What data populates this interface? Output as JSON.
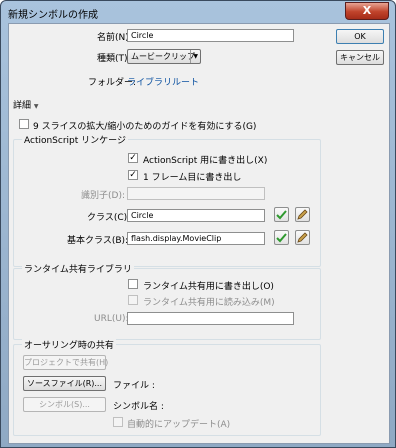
{
  "window": {
    "title": "新規シンボルの作成",
    "close": "X"
  },
  "form": {
    "name_label": "名前(N):",
    "name_value": "Circle",
    "type_label": "種類(T):",
    "type_value": "ムービークリップ",
    "folder_label": "フォルダー:",
    "folder_value": "ライブラリルート"
  },
  "buttons": {
    "ok": "OK",
    "cancel": "キャンセル"
  },
  "advanced": {
    "toggle": "詳細",
    "slice9": "9 スライスの拡大/縮小のためのガイドを有効にする(G)"
  },
  "actionscript": {
    "title": "ActionScript リンケージ",
    "export_as": "ActionScript 用に書き出し(X)",
    "export_frame1": "1 フレーム目に書き出し",
    "identifier_label": "識別子(D):",
    "class_label": "クラス(C):",
    "class_value": "Circle",
    "base_class_label": "基本クラス(B):",
    "base_class_value": "flash.display.MovieClip"
  },
  "runtime": {
    "title": "ランタイム共有ライブラリ",
    "export_sharing": "ランタイム共有用に書き出し(O)",
    "import_sharing": "ランタイム共有用に読み込み(M)",
    "url_label": "URL(U):"
  },
  "authoring": {
    "title": "オーサリング時の共有",
    "share_project": "プロジェクトで共有(H)",
    "source_file": "ソースファイル(R)...",
    "file_label": "ファイル :",
    "symbol_button": "シンボル(S)...",
    "symbol_name_label": "シンボル名 :",
    "auto_update": "自動的にアップデート(A)"
  },
  "colors": {
    "titlebar": "#a9c3dd",
    "client": "#f0f0f0",
    "link": "#0a50a0",
    "close": "#c0432b"
  }
}
